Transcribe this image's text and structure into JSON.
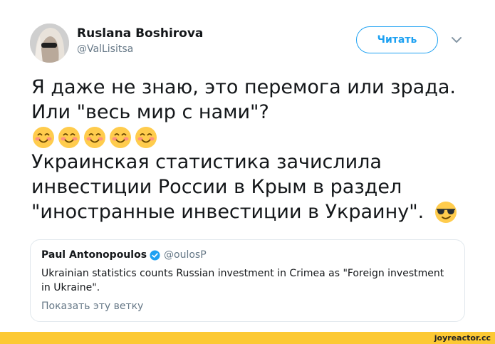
{
  "author": {
    "name": "Ruslana Boshirova",
    "handle": "@ValLisitsa"
  },
  "follow_button": {
    "label": "Читать"
  },
  "tweet": {
    "line1": "Я даже не знаю, это перемога или зрада.",
    "line2": "Или \"весь мир с нами\"?",
    "emoji_row_count": 5,
    "line3": "Украинская статистика зачислила",
    "line4": "инвестиции России в Крым в раздел",
    "line5": "\"иностранные инвестиции в Украину\"."
  },
  "quote": {
    "name": "Paul Antonopoulos",
    "handle": "@oulosP",
    "text": "Ukrainian statistics counts Russian investment in Crimea as \"Foreign investment in Ukraine\".",
    "show_thread": "Показать эту ветку"
  },
  "icons": {
    "avatar": "avatar-photo",
    "chevron": "chevron-down-icon",
    "smile": "smiling-face-icon",
    "sunglasses": "sunglasses-face-icon",
    "verified": "verified-badge-icon"
  },
  "colors": {
    "accent": "#1da1f2",
    "footer": "#fcc934",
    "secondary_text": "#657786"
  },
  "footer": {
    "credit": "joyreactor.cc"
  }
}
